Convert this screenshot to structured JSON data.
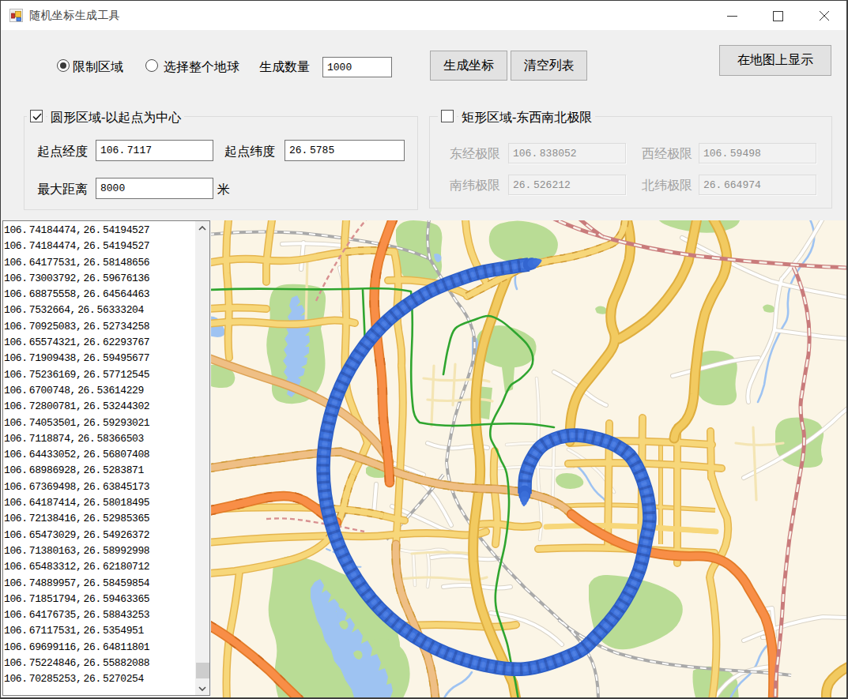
{
  "window": {
    "title": "随机坐标生成工具",
    "controls": {
      "minimize": "minimize",
      "maximize": "maximize",
      "close": "close"
    }
  },
  "toolbar": {
    "radio_limit_area": {
      "label": "限制区域",
      "selected": true
    },
    "radio_whole_earth": {
      "label": "选择整个地球",
      "selected": false
    },
    "count_label": "生成数量",
    "count_value": "1000",
    "generate_button": "生成坐标",
    "clear_button": "清空列表",
    "show_on_map_button": "在地图上显示"
  },
  "circle_group": {
    "title": "圆形区域-以起点为中心",
    "checked": true,
    "fields": [
      {
        "label": "起点经度",
        "value": "106.7117"
      },
      {
        "label": "起点纬度",
        "value": "26.5785"
      },
      {
        "label": "最大距离",
        "value": "8000",
        "suffix": "米"
      }
    ]
  },
  "rect_group": {
    "title": "矩形区域-东西南北极限",
    "checked": false,
    "fields": [
      {
        "label": "东经极限",
        "value": "106.838052"
      },
      {
        "label": "西经极限",
        "value": "106.59498"
      },
      {
        "label": "南纬极限",
        "value": "26.526212"
      },
      {
        "label": "北纬极限",
        "value": "26.664974"
      }
    ]
  },
  "coordinate_list": {
    "items": [
      "106.74184474,26.54194527",
      "106.74184474,26.54194527",
      "106.64177531,26.58148656",
      "106.73003792,26.59676136",
      "106.68875558,26.64564463",
      "106.7532664,26.56333204",
      "106.70925083,26.52734258",
      "106.65574321,26.62293767",
      "106.71909438,26.59495677",
      "106.75236169,26.57712545",
      "106.6700748,26.53614229",
      "106.72800781,26.53244302",
      "106.74053501,26.59293021",
      "106.7118874,26.58366503",
      "106.64433052,26.56807408",
      "106.68986928,26.5283871",
      "106.67369498,26.63845173",
      "106.64187414,26.58018495",
      "106.72138416,26.52985365",
      "106.65473029,26.54926372",
      "106.71380163,26.58992998",
      "106.65483312,26.62180712",
      "106.74889957,26.58459854",
      "106.71851794,26.59463365",
      "106.64176735,26.58843253",
      "106.67117531,26.5354951",
      "106.69699116,26.64811801",
      "106.75224846,26.55882088",
      "106.70285253,26.5270254"
    ]
  },
  "map": {
    "theme": {
      "land": "#fbf5e6",
      "park": "#b9dc95",
      "water": "#9ec3f2",
      "road_minor_fill": "#f7d77a",
      "road_minor_casing": "#e5b54e",
      "road_major_fill": "#f2ca60",
      "road_major_casing": "#dfae3f",
      "road_tan_fill": "#efbf85",
      "road_tan_casing": "#dda253",
      "road_orange_fill": "#f88e47",
      "road_orange_casing": "#e37b28",
      "railway_red": "#c97b7b",
      "railway_gray": "#a9a9a9",
      "route_green": "#2fa52f",
      "spiral_blue": "#3a6ed8",
      "spiral_blue_dark": "#2c5ec6"
    }
  }
}
